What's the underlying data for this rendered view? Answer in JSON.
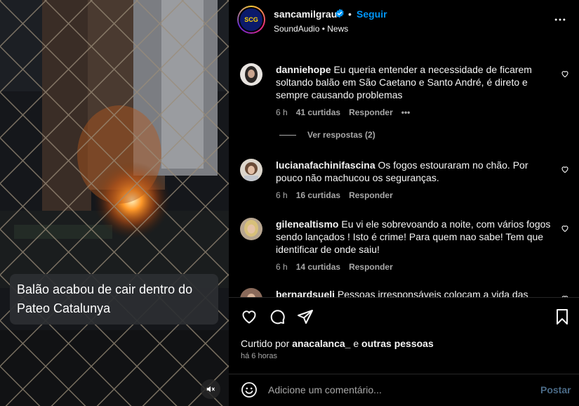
{
  "video": {
    "caption_line1": "Balão acabou de cair dentro do",
    "caption_line2": "Pateo Catalunya",
    "mute_icon": "speaker-muted-icon"
  },
  "header": {
    "username": "sancamilgrau",
    "separator": "•",
    "follow_label": "Seguir",
    "audio": "SoundAudio • News",
    "avatar_text": "SCG"
  },
  "comments": [
    {
      "username": "danniehope",
      "text": "Eu queria entender a necessidade de ficarem soltando balão em São Caetano e Santo André, é direto e sempre causando problemas",
      "time": "6 h",
      "likes": "41 curtidas",
      "reply": "Responder",
      "more": "•••",
      "view_replies": "Ver respostas (2)"
    },
    {
      "username": "lucianafachinifascina",
      "text": "Os fogos estouraram no chão. Por pouco não machucou os seguranças.",
      "time": "6 h",
      "likes": "16 curtidas",
      "reply": "Responder"
    },
    {
      "username": "gilenealtismo",
      "text": "Eu vi ele sobrevoando a noite, com vários fogos sendo lançados ! Isto é crime! Para quem nao sabe! Tem que identificar de onde saiu!",
      "time": "6 h",
      "likes": "14 curtidas",
      "reply": "Responder"
    },
    {
      "username": "bernardsueli",
      "text": "Pessoas irresponsáveis colocam a vida das"
    }
  ],
  "footer": {
    "liked_by_prefix": "Curtido por",
    "liked_by_user": "anacalanca_",
    "liked_by_mid": "e",
    "liked_by_others": "outras pessoas",
    "time": "há 6 horas",
    "comment_placeholder": "Adicione um comentário...",
    "post_label": "Postar"
  },
  "colors": {
    "accent": "#0095f6",
    "muted": "#a8a8a8",
    "post_disabled": "#4a6a86"
  }
}
